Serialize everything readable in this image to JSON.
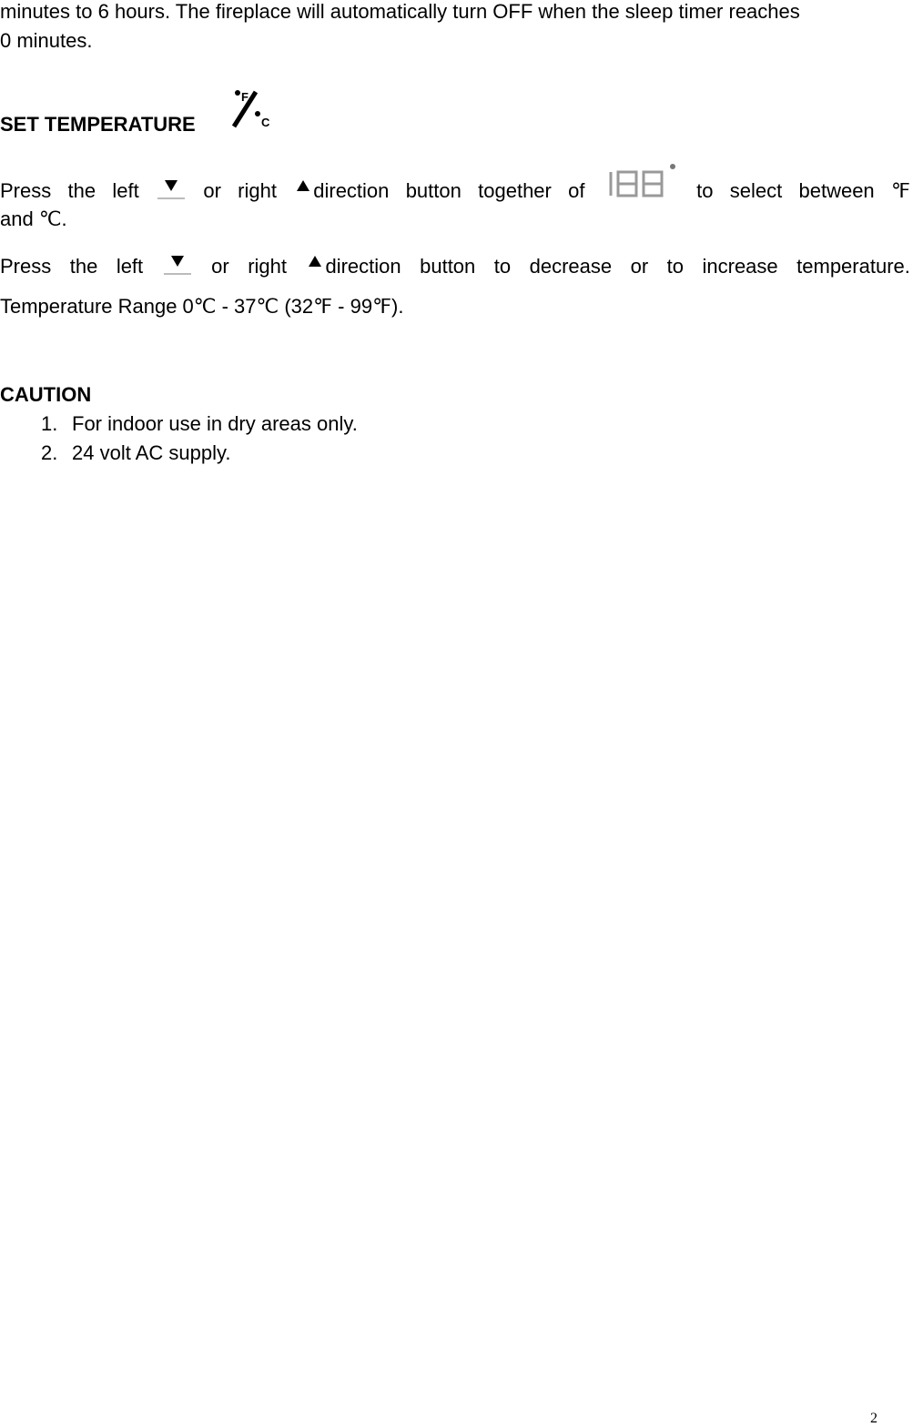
{
  "intro": {
    "line1": "minutes to 6 hours. The fireplace will automatically turn OFF when the sleep timer reaches",
    "line2": "0 minutes."
  },
  "set_temperature": {
    "heading": "SET TEMPERATURE",
    "heading_icon": "fahrenheit-celsius-icon",
    "para1": {
      "w1": "Press",
      "w2": "the",
      "w3": "left",
      "w4": "or",
      "w5": "right",
      "w6": "direction",
      "w7": "button",
      "w8": "together",
      "w9": "of",
      "w10": "to",
      "w11": "select",
      "w12": "between",
      "w13": "℉",
      "line2": "and ℃."
    },
    "para2": {
      "w1": "Press",
      "w2": "the",
      "w3": "left",
      "w4": "or",
      "w5": "right",
      "w6": "direction",
      "w7": "button",
      "w8": "to",
      "w9": "decrease",
      "w10": "or",
      "w11": "to",
      "w12": "increase",
      "w13": "temperature."
    },
    "range": "Temperature Range 0℃ - 37℃ (32℉ - 99℉)."
  },
  "caution": {
    "heading": "CAUTION",
    "items": [
      {
        "num": "1.",
        "text": "For indoor use in dry areas only."
      },
      {
        "num": "2.",
        "text": "24 volt AC supply."
      }
    ]
  },
  "page_number": "2"
}
